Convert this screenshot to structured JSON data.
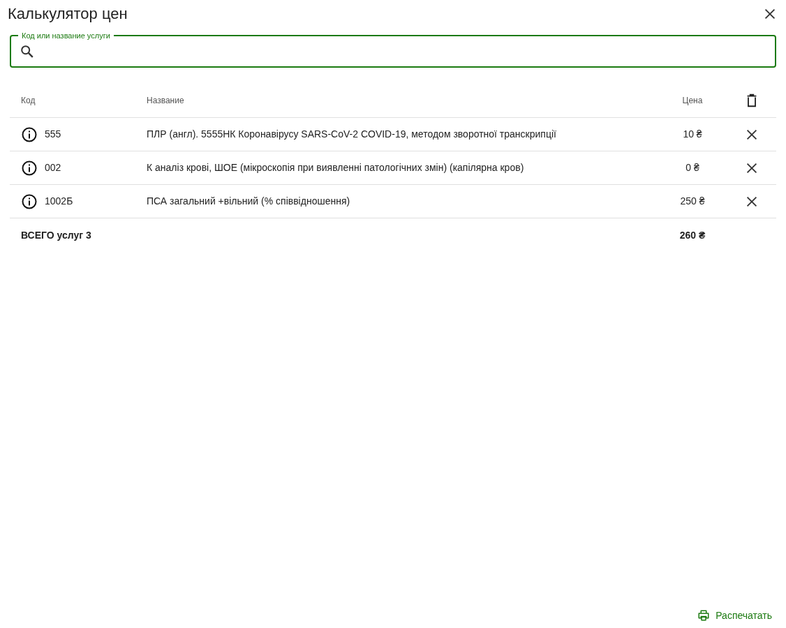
{
  "dialog": {
    "title": "Калькулятор цен"
  },
  "search": {
    "label": "Код или название услуги",
    "focused": true
  },
  "table": {
    "columns": [
      "Код",
      "Название",
      "Цена"
    ],
    "rows": [
      {
        "code": "555",
        "name": "ПЛР (англ). 5555НК Коронавірусу SARS-CoV-2 COVID-19, методом зворотної транскрипції",
        "price": "10 ₴"
      },
      {
        "code": "002",
        "name": "К аналіз крові, ШОЕ (мікроскопія при виявленні патологічних змін) (капілярна кров)",
        "price": "0 ₴"
      },
      {
        "code": "1002Б",
        "name": "ПСА загальний +вільний (% співвідношення)",
        "price": "250 ₴"
      }
    ],
    "total": {
      "label": "ВСЕГО услуг 3",
      "price": "260 ₴"
    }
  },
  "footer": {
    "print_button": "Распечатать"
  }
}
